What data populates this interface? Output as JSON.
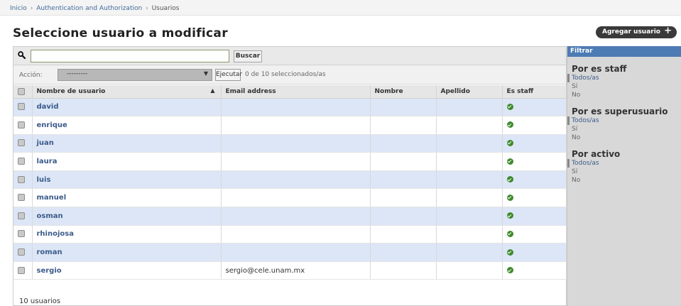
{
  "breadcrumb": {
    "home": "Inicio",
    "app": "Authentication and Authorization",
    "current": "Usuarios",
    "separator": "›"
  },
  "page": {
    "title": "Seleccione usuario a modificar",
    "add_button": "Agregar usuario",
    "add_icon": "+"
  },
  "search": {
    "value": "",
    "placeholder": "",
    "button": "Buscar",
    "icon": "search-icon"
  },
  "actions": {
    "label": "Acción:",
    "selected": "---------",
    "execute_button": "Ejecutar",
    "counter": "0 de 10 seleccionados/as"
  },
  "table": {
    "columns": [
      "Nombre de usuario",
      "Email address",
      "Nombre",
      "Apellido",
      "Es staff"
    ],
    "sort_indicator": "▲",
    "rows": [
      {
        "username": "david",
        "email": "",
        "first_name": "",
        "last_name": "",
        "is_staff": true
      },
      {
        "username": "enrique",
        "email": "",
        "first_name": "",
        "last_name": "",
        "is_staff": true
      },
      {
        "username": "juan",
        "email": "",
        "first_name": "",
        "last_name": "",
        "is_staff": true
      },
      {
        "username": "laura",
        "email": "",
        "first_name": "",
        "last_name": "",
        "is_staff": true
      },
      {
        "username": "luis",
        "email": "",
        "first_name": "",
        "last_name": "",
        "is_staff": true
      },
      {
        "username": "manuel",
        "email": "",
        "first_name": "",
        "last_name": "",
        "is_staff": true
      },
      {
        "username": "osman",
        "email": "",
        "first_name": "",
        "last_name": "",
        "is_staff": true
      },
      {
        "username": "rhinojosa",
        "email": "",
        "first_name": "",
        "last_name": "",
        "is_staff": true
      },
      {
        "username": "roman",
        "email": "",
        "first_name": "",
        "last_name": "",
        "is_staff": true
      },
      {
        "username": "sergio",
        "email": "sergio@cele.unam.mx",
        "first_name": "",
        "last_name": "",
        "is_staff": true
      }
    ]
  },
  "paginator": {
    "text": "10 usuarios"
  },
  "filter": {
    "header": "Filtrar",
    "groups": [
      {
        "title": "Por es staff",
        "options": [
          "Todos/as",
          "Sí",
          "No"
        ],
        "selected": "Todos/as"
      },
      {
        "title": "Por es superusuario",
        "options": [
          "Todos/as",
          "Sí",
          "No"
        ],
        "selected": "Todos/as"
      },
      {
        "title": "Por activo",
        "options": [
          "Todos/as",
          "Sí",
          "No"
        ],
        "selected": "Todos/as"
      }
    ]
  },
  "colors": {
    "row_alt": "#dce6f6",
    "filter_header": "#4d7bb3",
    "link": "#3b5b8a",
    "staff_icon": "#3e8a2d"
  }
}
